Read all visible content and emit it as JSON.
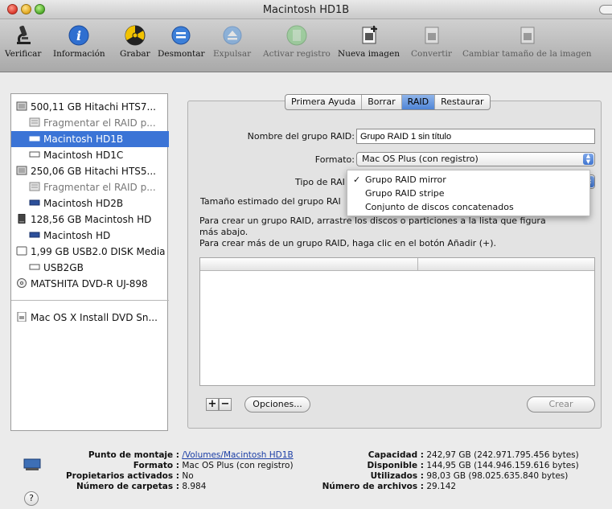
{
  "window": {
    "title": "Macintosh HD1B"
  },
  "toolbar": [
    {
      "label": "Verificar",
      "icon": "microscope-icon",
      "enabled": true
    },
    {
      "label": "Información",
      "icon": "info-icon",
      "enabled": true
    },
    {
      "label": "Grabar",
      "icon": "burn-icon",
      "enabled": true
    },
    {
      "label": "Desmontar",
      "icon": "unmount-icon",
      "enabled": true
    },
    {
      "label": "Expulsar",
      "icon": "eject-icon",
      "enabled": false
    },
    {
      "label": "Activar registro",
      "icon": "journal-icon",
      "enabled": false
    },
    {
      "label": "Nueva imagen",
      "icon": "new-image-icon",
      "enabled": true
    },
    {
      "label": "Convertir",
      "icon": "convert-icon",
      "enabled": false
    },
    {
      "label": "Cambiar tamaño de la imagen",
      "icon": "resize-image-icon",
      "enabled": false
    }
  ],
  "sidebar": {
    "items": [
      {
        "label": "500,11 GB Hitachi HTS7...",
        "icon": "hard-disk-icon",
        "level": 0,
        "state": "normal"
      },
      {
        "label": "Fragmentar el RAID p...",
        "icon": "raid-volume-icon",
        "level": 1,
        "state": "grey"
      },
      {
        "label": "Macintosh HD1B",
        "icon": "volume-icon",
        "level": 1,
        "state": "selected"
      },
      {
        "label": "Macintosh HD1C",
        "icon": "volume-outline-icon",
        "level": 1,
        "state": "normal"
      },
      {
        "label": "250,06 GB Hitachi HTS5...",
        "icon": "hard-disk-icon",
        "level": 0,
        "state": "normal"
      },
      {
        "label": "Fragmentar el RAID p...",
        "icon": "raid-volume-icon",
        "level": 1,
        "state": "grey"
      },
      {
        "label": "Macintosh HD2B",
        "icon": "volume-blue-icon",
        "level": 1,
        "state": "normal"
      },
      {
        "label": "128,56 GB Macintosh HD",
        "icon": "external-disk-icon",
        "level": 0,
        "state": "normal"
      },
      {
        "label": "Macintosh HD",
        "icon": "volume-blue-icon",
        "level": 1,
        "state": "normal"
      },
      {
        "label": "1,99 GB USB2.0 DISK Media",
        "icon": "usb-disk-icon",
        "level": 0,
        "state": "normal"
      },
      {
        "label": "USB2GB",
        "icon": "volume-outline-icon",
        "level": 1,
        "state": "normal"
      },
      {
        "label": "MATSHITA DVD-R UJ-898",
        "icon": "optical-drive-icon",
        "level": 0,
        "state": "normal"
      }
    ],
    "image_items": [
      {
        "label": "Mac OS X Install DVD Sn...",
        "icon": "disk-image-icon"
      }
    ]
  },
  "tabs": [
    {
      "label": "Primera Ayuda",
      "active": false
    },
    {
      "label": "Borrar",
      "active": false
    },
    {
      "label": "RAID",
      "active": true
    },
    {
      "label": "Restaurar",
      "active": false
    }
  ],
  "raid_form": {
    "name_label": "Nombre del grupo RAID:",
    "name_value": "Grupo RAID 1 sin título",
    "format_label": "Formato:",
    "format_value": "Mac OS Plus (con registro)",
    "type_label": "Tipo de RAI",
    "size_label": "Tamaño estimado del grupo RAI",
    "type_menu": [
      {
        "label": "Grupo RAID mirror",
        "checked": true
      },
      {
        "label": "Grupo RAID stripe",
        "checked": false
      },
      {
        "label": "Conjunto de discos concatenados",
        "checked": false
      }
    ],
    "instructions": [
      "Para crear un grupo RAID, arrastre los discos o particiones a la lista que figura",
      "más abajo.",
      "Para crear más de un grupo RAID, haga clic en el botón Añadir (+)."
    ],
    "add_label": "+",
    "remove_label": "−",
    "options_label": "Opciones...",
    "create_label": "Crear"
  },
  "info": {
    "mount_point_key": "Punto de montaje :",
    "mount_point_value": "/Volumes/Macintosh HD1B",
    "format_key": "Formato :",
    "format_value": "Mac OS Plus (con registro)",
    "owners_key": "Propietarios activados :",
    "owners_value": "No",
    "folders_key": "Número de carpetas :",
    "folders_value": "8.984",
    "capacity_key": "Capacidad :",
    "capacity_value": "242,97 GB (242.971.795.456 bytes)",
    "available_key": "Disponible :",
    "available_value": "144,95 GB (144.946.159.616 bytes)",
    "used_key": "Utilizados :",
    "used_value": "98,03 GB (98.025.635.840 bytes)",
    "files_key": "Número de archivos :",
    "files_value": "29.142",
    "help_label": "?"
  },
  "colors": {
    "selection": "#3b74d6",
    "link": "#1b3ea6"
  }
}
